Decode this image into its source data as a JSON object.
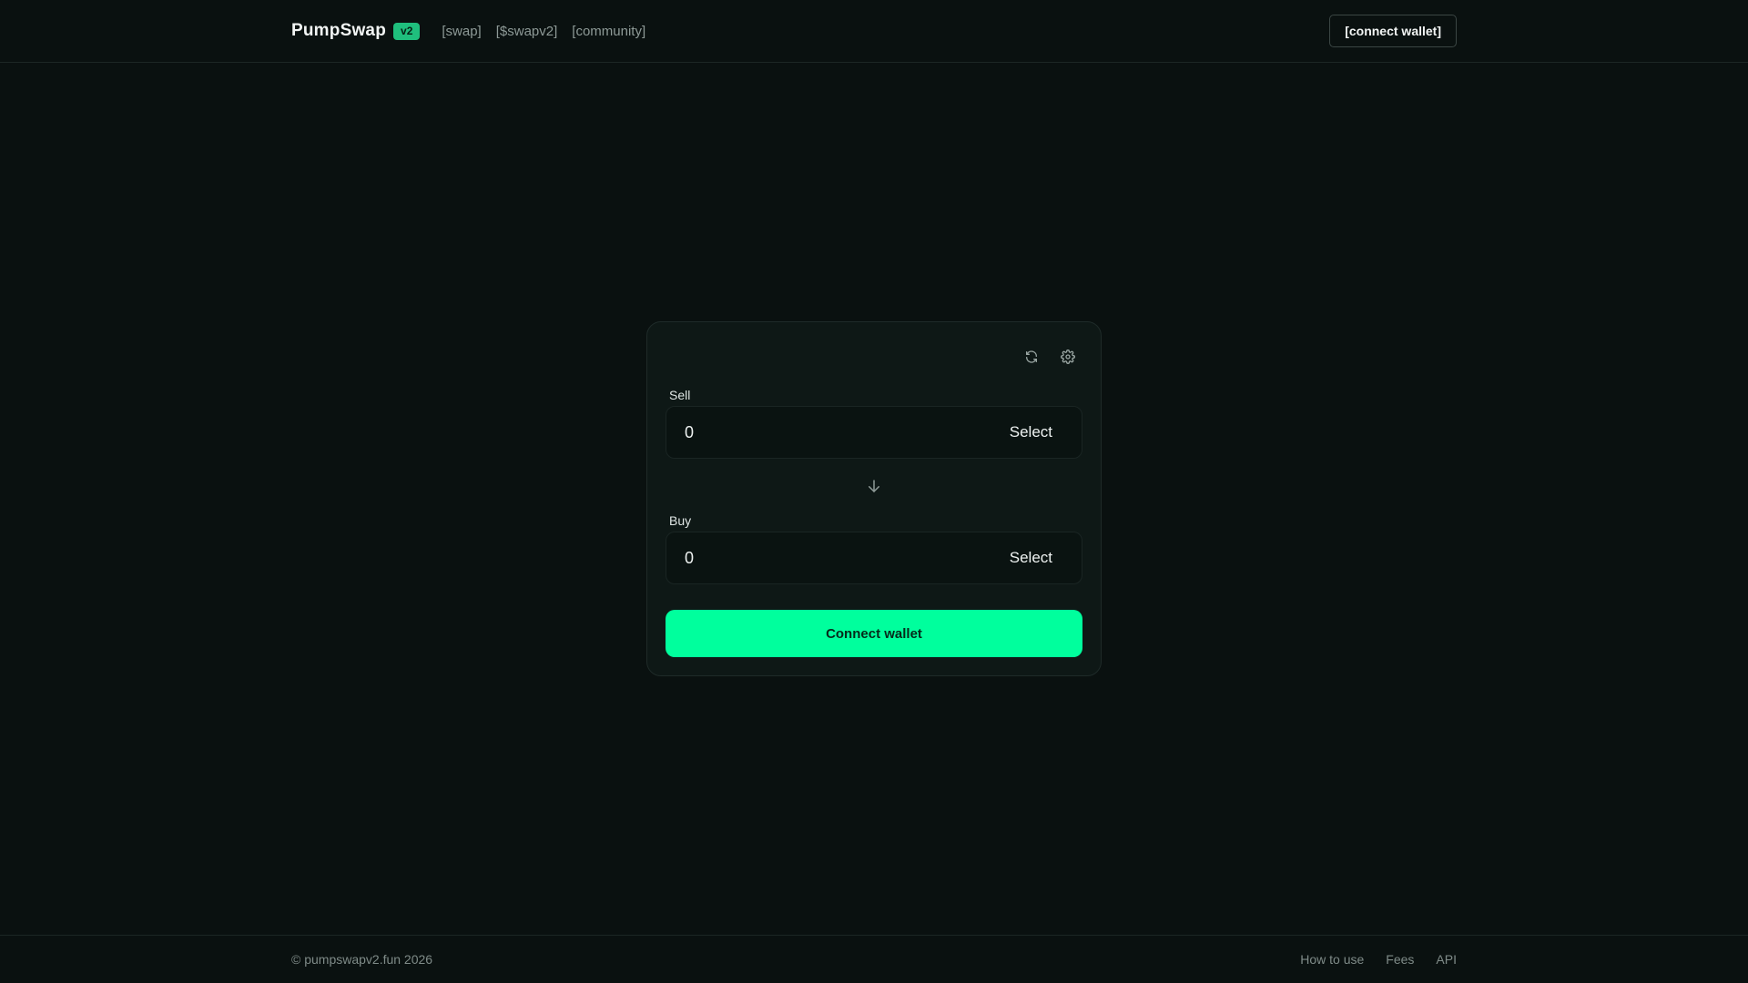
{
  "header": {
    "brand": "PumpSwap",
    "badge": "v2",
    "nav": [
      "[swap]",
      "[$swapv2]",
      "[community]"
    ],
    "connect_label": "[connect wallet]"
  },
  "swap": {
    "refresh_icon": "refresh-icon",
    "settings_icon": "gear-icon",
    "sell": {
      "label": "Sell",
      "amount": "0",
      "token_button": "Select"
    },
    "switch_icon": "arrow-down-icon",
    "buy": {
      "label": "Buy",
      "amount": "0",
      "token_button": "Select"
    },
    "connect_label": "Connect wallet"
  },
  "footer": {
    "copyright": "© pumpswapv2.fun 2026",
    "links": [
      "How to use",
      "Fees",
      "API"
    ]
  },
  "colors": {
    "background": "#0a1110",
    "accent": "#00ff9d",
    "badge": "#1fbf7d",
    "card": "#0e1816"
  }
}
